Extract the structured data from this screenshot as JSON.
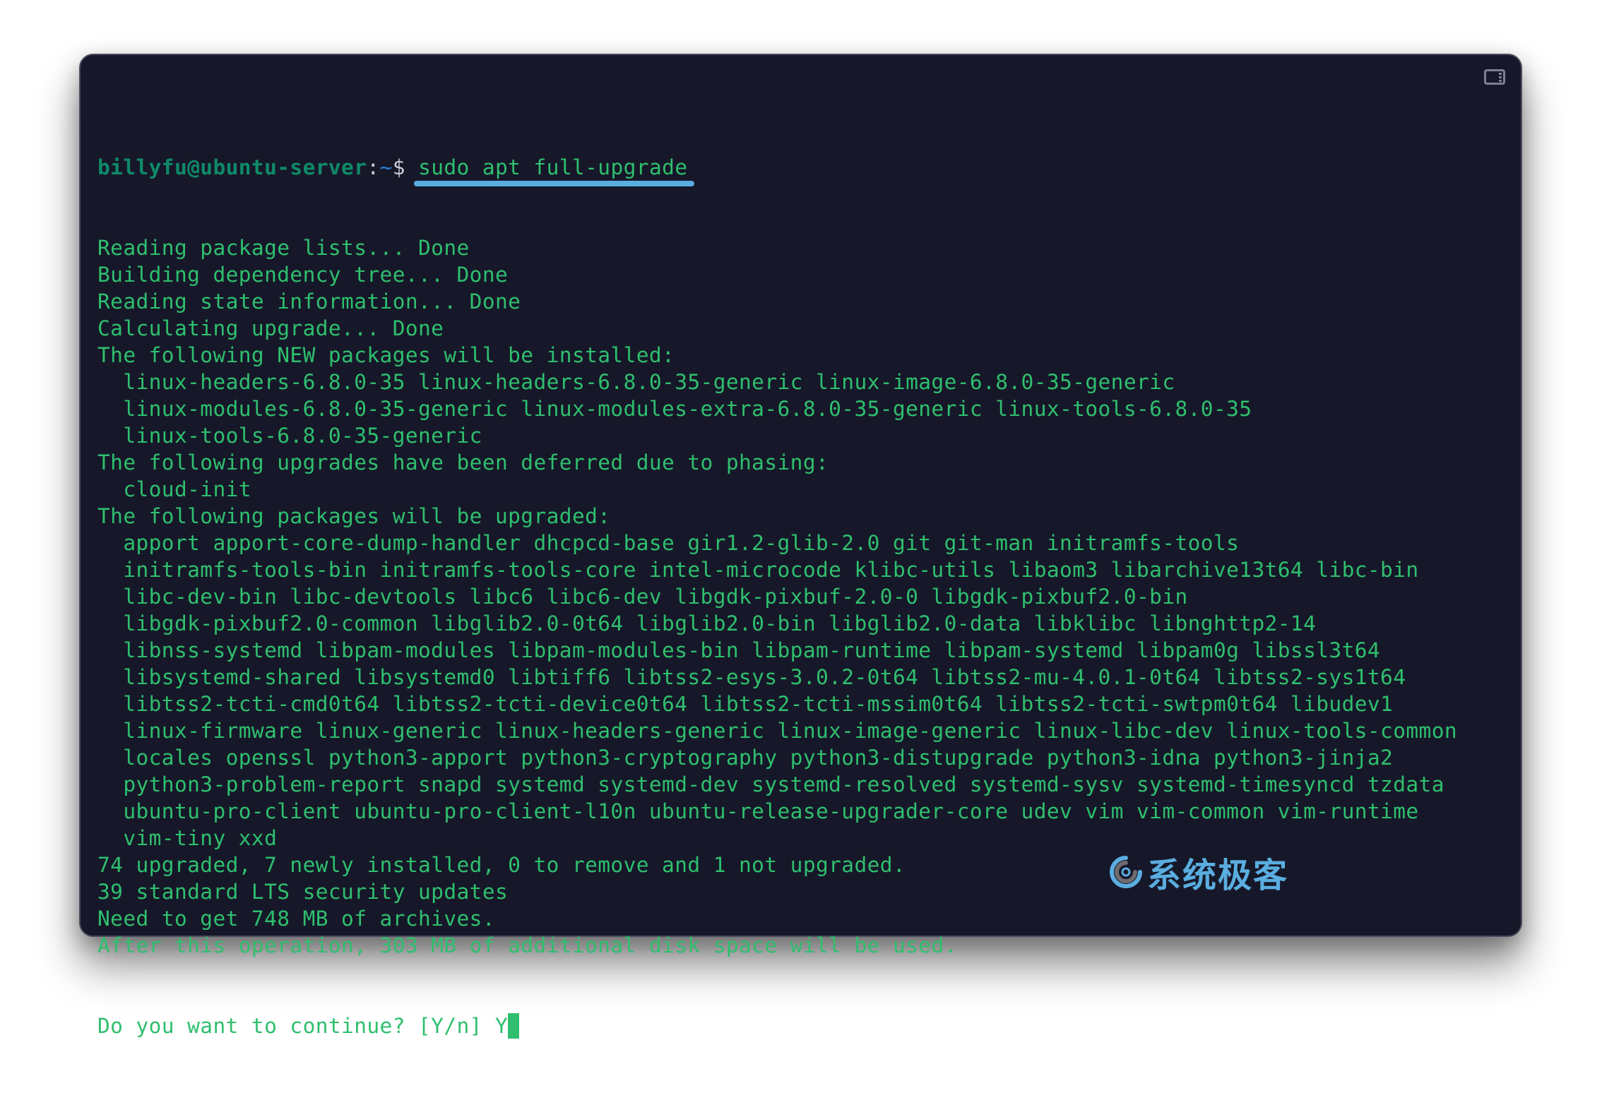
{
  "terminal": {
    "prompt": {
      "user_host": "billyfu@ubuntu-server",
      "colon": ":",
      "path": "~",
      "symbol": "$",
      "command": "sudo apt full-upgrade"
    },
    "output_lines": [
      "Reading package lists... Done",
      "Building dependency tree... Done",
      "Reading state information... Done",
      "Calculating upgrade... Done",
      "The following NEW packages will be installed:",
      "  linux-headers-6.8.0-35 linux-headers-6.8.0-35-generic linux-image-6.8.0-35-generic",
      "  linux-modules-6.8.0-35-generic linux-modules-extra-6.8.0-35-generic linux-tools-6.8.0-35",
      "  linux-tools-6.8.0-35-generic",
      "The following upgrades have been deferred due to phasing:",
      "  cloud-init",
      "The following packages will be upgraded:",
      "  apport apport-core-dump-handler dhcpcd-base gir1.2-glib-2.0 git git-man initramfs-tools",
      "  initramfs-tools-bin initramfs-tools-core intel-microcode klibc-utils libaom3 libarchive13t64 libc-bin",
      "  libc-dev-bin libc-devtools libc6 libc6-dev libgdk-pixbuf-2.0-0 libgdk-pixbuf2.0-bin",
      "  libgdk-pixbuf2.0-common libglib2.0-0t64 libglib2.0-bin libglib2.0-data libklibc libnghttp2-14",
      "  libnss-systemd libpam-modules libpam-modules-bin libpam-runtime libpam-systemd libpam0g libssl3t64",
      "  libsystemd-shared libsystemd0 libtiff6 libtss2-esys-3.0.2-0t64 libtss2-mu-4.0.1-0t64 libtss2-sys1t64",
      "  libtss2-tcti-cmd0t64 libtss2-tcti-device0t64 libtss2-tcti-mssim0t64 libtss2-tcti-swtpm0t64 libudev1",
      "  linux-firmware linux-generic linux-headers-generic linux-image-generic linux-libc-dev linux-tools-common",
      "  locales openssl python3-apport python3-cryptography python3-distupgrade python3-idna python3-jinja2",
      "  python3-problem-report snapd systemd systemd-dev systemd-resolved systemd-sysv systemd-timesyncd tzdata",
      "  ubuntu-pro-client ubuntu-pro-client-l10n ubuntu-release-upgrader-core udev vim vim-common vim-runtime",
      "  vim-tiny xxd",
      "74 upgraded, 7 newly installed, 0 to remove and 1 not upgraded.",
      "39 standard LTS security updates",
      "Need to get 748 MB of archives.",
      "After this operation, 303 MB of additional disk space will be used."
    ],
    "input_prompt": "Do you want to continue? [Y/n] ",
    "input_value": "Y"
  },
  "toolbar": {
    "split_pane_icon": "split-pane-icon"
  },
  "watermark": {
    "text": "系统极客",
    "logo_icon": "swirl-logo-icon"
  },
  "colors": {
    "background": "#161829",
    "output_text": "#2fbf6e",
    "prompt_user": "#0f8a68",
    "prompt_path": "#2d7fd6",
    "highlight_underline": "#5aade0",
    "watermark": "#5aade0"
  }
}
